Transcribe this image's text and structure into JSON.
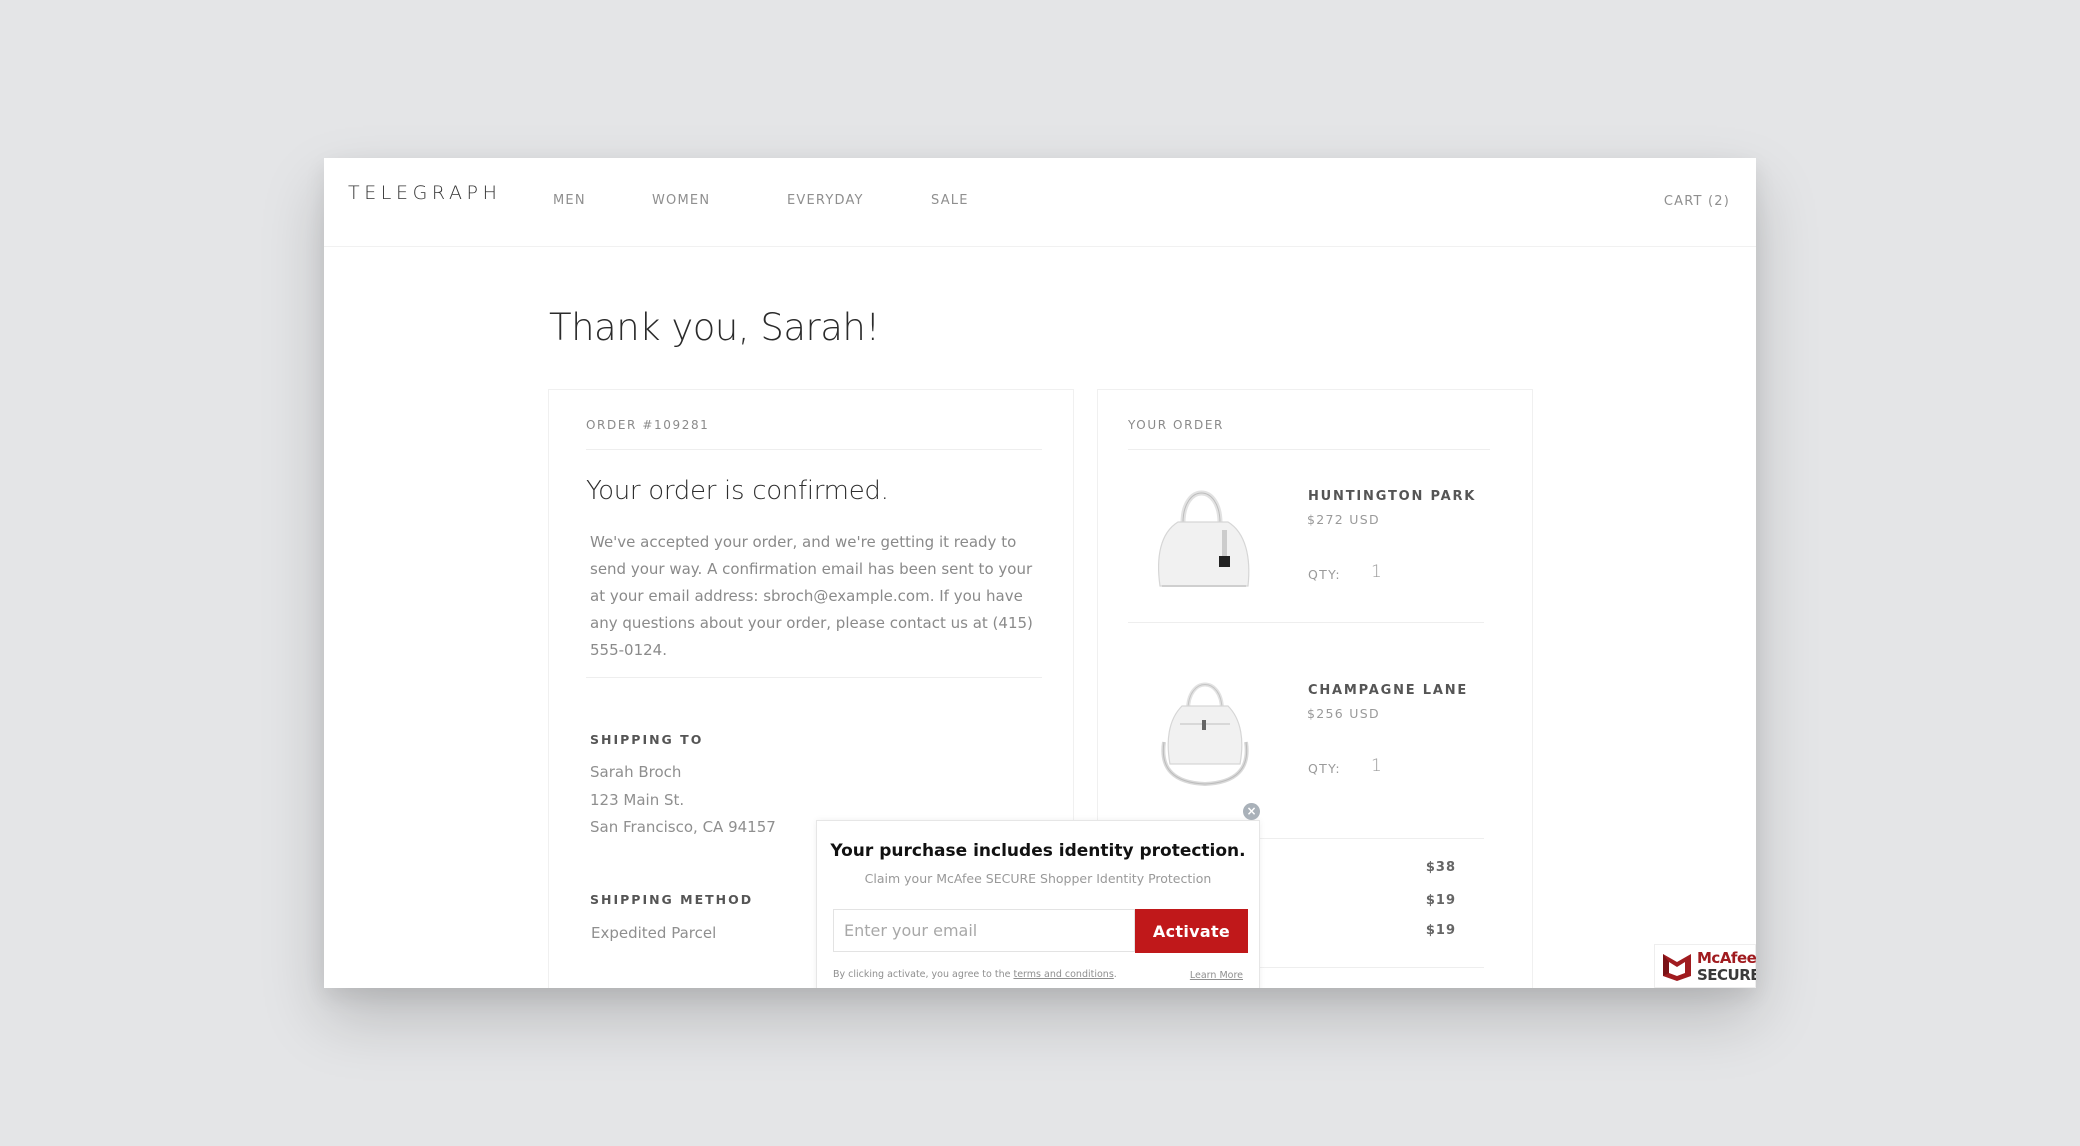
{
  "header": {
    "logo": "TELEGRAPH",
    "nav": [
      {
        "label": "MEN"
      },
      {
        "label": "WOMEN"
      },
      {
        "label": "EVERYDAY"
      },
      {
        "label": "SALE"
      }
    ],
    "cart_label": "CART (2)"
  },
  "page_title": "Thank you, Sarah!",
  "order": {
    "number_label": "ORDER #109281",
    "heading": "Your order is confirmed.",
    "message": "We've accepted your order, and we're getting it ready to send your way. A confirmation email has been sent to your at your email address: sbroch@example.com. If you have any questions about your order, please contact us at (415) 555-0124.",
    "shipping_to_label": "SHIPPING TO",
    "shipping_address": [
      "Sarah Broch",
      "123 Main St.",
      "San Francisco, CA 94157"
    ],
    "shipping_method_label": "SHIPPING METHOD",
    "shipping_method": "Expedited Parcel"
  },
  "your_order": {
    "label": "YOUR ORDER",
    "qty_label": "QTY:",
    "items": [
      {
        "name": "HUNTINGTON PARK",
        "price": "$272 USD",
        "qty": "1",
        "image": "white-handbag-icon"
      },
      {
        "name": "CHAMPAGNE LANE",
        "price": "$256 USD",
        "qty": "1",
        "image": "white-crossbody-bag-icon"
      }
    ],
    "totals": [
      "$38",
      "$19",
      "$19"
    ]
  },
  "popup": {
    "title": "Your purchase includes identity protection.",
    "subtitle": "Claim your McAfee SECURE Shopper Identity Protection",
    "email_placeholder": "Enter your email",
    "email_value": "",
    "activate_label": "Activate",
    "footer_prefix": "By clicking activate, you agree to the ",
    "terms_link": "terms and conditions",
    "footer_suffix": ".",
    "learn_more": "Learn More",
    "close_icon": "close-icon",
    "accent_color": "#c0181a"
  },
  "badge": {
    "line1": "McAfee",
    "line2": "SECURE",
    "trademark": "™"
  }
}
